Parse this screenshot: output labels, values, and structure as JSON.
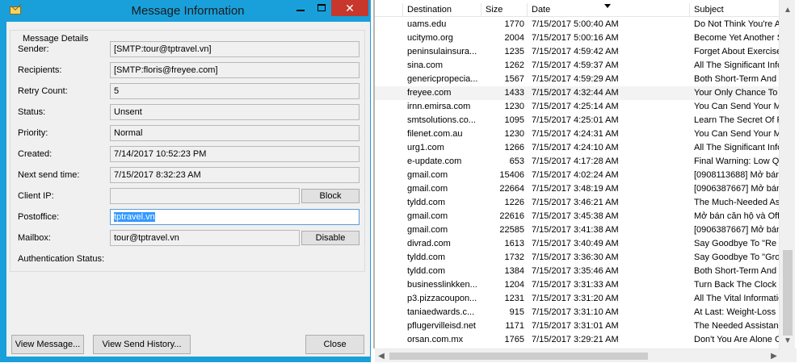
{
  "window": {
    "title": "Message Information",
    "close_glyph": "✕"
  },
  "details": {
    "legend": "Message Details",
    "rows": [
      {
        "label": "Sender:",
        "value": "[SMTP:tour@tptravel.vn]"
      },
      {
        "label": "Recipients:",
        "value": "[SMTP:floris@freyee.com]"
      },
      {
        "label": "Retry Count:",
        "value": "5"
      },
      {
        "label": "Status:",
        "value": "Unsent"
      },
      {
        "label": "Priority:",
        "value": "Normal"
      },
      {
        "label": "Created:",
        "value": "7/14/2017 10:52:23 PM"
      },
      {
        "label": "Next send time:",
        "value": "7/15/2017 8:32:23 AM"
      },
      {
        "label": "Client IP:",
        "value": ""
      },
      {
        "label": "Postoffice:",
        "value": "tptravel.vn"
      },
      {
        "label": "Mailbox:",
        "value": "tour@tptravel.vn"
      },
      {
        "label": "Authentication Status:",
        "value": ""
      }
    ],
    "block_label": "Block",
    "disable_label": "Disable"
  },
  "buttons": {
    "view_message": "View Message...",
    "view_history": "View Send History...",
    "close": "Close"
  },
  "grid": {
    "columns": [
      "Destination",
      "Size",
      "Date",
      "Subject"
    ],
    "sorted_column": "Date",
    "selected_row": "freyee.com",
    "rows": [
      {
        "dest": "uams.edu",
        "size": "1770",
        "date": "7/15/2017 5:00:40 AM",
        "subject": "Do Not Think You're A"
      },
      {
        "dest": "ucitymo.org",
        "size": "2004",
        "date": "7/15/2017 5:00:16 AM",
        "subject": "Become Yet Another S"
      },
      {
        "dest": "peninsulainsura...",
        "size": "1235",
        "date": "7/15/2017 4:59:42 AM",
        "subject": "Forget About Exercise"
      },
      {
        "dest": "sina.com",
        "size": "1262",
        "date": "7/15/2017 4:59:37 AM",
        "subject": "All The Significant Info"
      },
      {
        "dest": "genericpropecia...",
        "size": "1567",
        "date": "7/15/2017 4:59:29 AM",
        "subject": "Both Short-Term And L"
      },
      {
        "dest": "freyee.com",
        "size": "1433",
        "date": "7/15/2017 4:32:44 AM",
        "subject": "Your Only Chance To"
      },
      {
        "dest": "irnn.emirsa.com",
        "size": "1230",
        "date": "7/15/2017 4:25:14 AM",
        "subject": "You Can Send Your M"
      },
      {
        "dest": "smtsolutions.co...",
        "size": "1095",
        "date": "7/15/2017 4:25:01 AM",
        "subject": "Learn The Secret Of P"
      },
      {
        "dest": "filenet.com.au",
        "size": "1230",
        "date": "7/15/2017 4:24:31 AM",
        "subject": "You Can Send Your M"
      },
      {
        "dest": "urg1.com",
        "size": "1266",
        "date": "7/15/2017 4:24:10 AM",
        "subject": "All The Significant Info"
      },
      {
        "dest": "e-update.com",
        "size": "653",
        "date": "7/15/2017 4:17:28 AM",
        "subject": "Final Warning: Low Qu"
      },
      {
        "dest": "gmail.com",
        "size": "15406",
        "date": "7/15/2017 4:02:24 AM",
        "subject": "[0908113688] Mở bán"
      },
      {
        "dest": "gmail.com",
        "size": "22664",
        "date": "7/15/2017 3:48:19 AM",
        "subject": "[0906387667] Mở bán"
      },
      {
        "dest": "tyldd.com",
        "size": "1226",
        "date": "7/15/2017 3:46:21 AM",
        "subject": "The Much-Needed Ass"
      },
      {
        "dest": "gmail.com",
        "size": "22616",
        "date": "7/15/2017 3:45:38 AM",
        "subject": "Mở bán căn hộ và Off"
      },
      {
        "dest": "gmail.com",
        "size": "22585",
        "date": "7/15/2017 3:41:38 AM",
        "subject": "[0906387667] Mở bán"
      },
      {
        "dest": "divrad.com",
        "size": "1613",
        "date": "7/15/2017 3:40:49 AM",
        "subject": "Say Goodbye To \"Re"
      },
      {
        "dest": "tyldd.com",
        "size": "1732",
        "date": "7/15/2017 3:36:30 AM",
        "subject": "Say Goodbye To \"Gro"
      },
      {
        "dest": "tyldd.com",
        "size": "1384",
        "date": "7/15/2017 3:35:46 AM",
        "subject": "Both Short-Term And L"
      },
      {
        "dest": "businesslinkken...",
        "size": "1204",
        "date": "7/15/2017 3:31:33 AM",
        "subject": "Turn Back The Clock"
      },
      {
        "dest": "p3.pizzacoupon...",
        "size": "1231",
        "date": "7/15/2017 3:31:20 AM",
        "subject": "All The Vital Informatio"
      },
      {
        "dest": "taniaedwards.c...",
        "size": "915",
        "date": "7/15/2017 3:31:10 AM",
        "subject": "At Last: Weight-Loss S"
      },
      {
        "dest": "pflugervilleisd.net",
        "size": "1171",
        "date": "7/15/2017 3:31:01 AM",
        "subject": "The Needed Assistanc"
      },
      {
        "dest": "orsan.com.mx",
        "size": "1765",
        "date": "7/15/2017 3:29:21 AM",
        "subject": "Don't You Are Alone C"
      }
    ]
  }
}
